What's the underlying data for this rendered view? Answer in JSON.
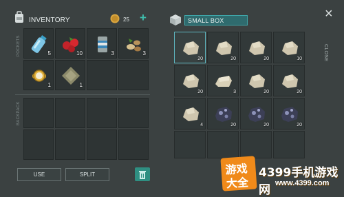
{
  "inventory": {
    "title": "INVENTORY",
    "coins": "25",
    "add_label": "+",
    "pockets_label": "POCKETS",
    "backpack_label": "BACKPACK",
    "pocket_items": [
      {
        "name": "water-bottle",
        "count": "5"
      },
      {
        "name": "berries",
        "count": "10"
      },
      {
        "name": "canned-food",
        "count": "3"
      },
      {
        "name": "seeds",
        "count": "3"
      },
      {
        "name": "gold-watch",
        "count": "1"
      },
      {
        "name": "cloth-scrap",
        "count": "1"
      }
    ],
    "use_label": "USE",
    "split_label": "SPLIT"
  },
  "box": {
    "title": "SMALL BOX",
    "close_label": "CLOSE",
    "close_icon": "×",
    "items": [
      {
        "name": "stone",
        "count": "20"
      },
      {
        "name": "stone",
        "count": "20"
      },
      {
        "name": "stone",
        "count": "20"
      },
      {
        "name": "stone",
        "count": "10"
      },
      {
        "name": "stone",
        "count": "20"
      },
      {
        "name": "limestone",
        "count": "3"
      },
      {
        "name": "stone",
        "count": "20"
      },
      {
        "name": "stone",
        "count": "20"
      },
      {
        "name": "stone",
        "count": "4"
      },
      {
        "name": "iron-ore",
        "count": "20"
      },
      {
        "name": "iron-ore",
        "count": "20"
      },
      {
        "name": "iron-ore",
        "count": "20"
      }
    ]
  },
  "watermark": {
    "badge_top": "游戏",
    "badge_bottom": "大全",
    "brand": "4399手机游戏网",
    "url": "www.4399.com"
  },
  "colors": {
    "accent": "#3fbfae",
    "selected": "#5fb8c2",
    "brand_orange": "#f08a1a"
  }
}
